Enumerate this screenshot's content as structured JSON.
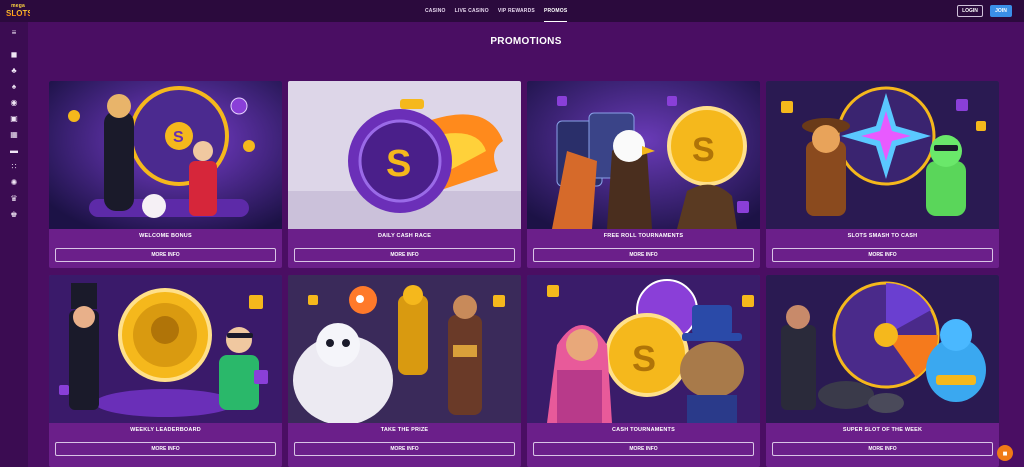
{
  "brand": {
    "line1": "mega",
    "line2": "SLOTS"
  },
  "nav": [
    {
      "label": "CASINO",
      "active": false
    },
    {
      "label": "LIVE CASINO",
      "active": false
    },
    {
      "label": "VIP REWARDS",
      "active": false
    },
    {
      "label": "PROMOS",
      "active": true
    }
  ],
  "auth": {
    "login": "LOGIN",
    "join": "JOIN"
  },
  "sidebar": [
    {
      "icon": "menu-icon",
      "glyph": "≡"
    },
    {
      "icon": "chat-icon",
      "glyph": "◼"
    },
    {
      "icon": "cherry-icon",
      "glyph": "♣"
    },
    {
      "icon": "spade-icon",
      "glyph": "♠"
    },
    {
      "icon": "hat-icon",
      "glyph": "◉"
    },
    {
      "icon": "cards-icon",
      "glyph": "▣"
    },
    {
      "icon": "ticket-icon",
      "glyph": "▦"
    },
    {
      "icon": "table-icon",
      "glyph": "▬"
    },
    {
      "icon": "grid-icon",
      "glyph": "∷"
    },
    {
      "icon": "chip-icon",
      "glyph": "✺"
    },
    {
      "icon": "trophy-icon",
      "glyph": "♛"
    },
    {
      "icon": "crown-icon",
      "glyph": "♚"
    }
  ],
  "page": {
    "title": "PROMOTIONS"
  },
  "promos": [
    {
      "name": "WELCOME BONUS",
      "button": "MORE INFO",
      "theme": "welcome"
    },
    {
      "name": "DAILY CASH RACE",
      "button": "MORE INFO",
      "theme": "race"
    },
    {
      "name": "FREE ROLL TOURNAMENTS",
      "button": "MORE INFO",
      "theme": "freeroll"
    },
    {
      "name": "SLOTS SMASH TO CASH",
      "button": "MORE INFO",
      "theme": "smash"
    },
    {
      "name": "WEEKLY LEADERBOARD",
      "button": "MORE INFO",
      "theme": "leaderboard"
    },
    {
      "name": "TAKE THE PRIZE",
      "button": "MORE INFO",
      "theme": "prize"
    },
    {
      "name": "CASH TOURNAMENTS",
      "button": "MORE INFO",
      "theme": "cash"
    },
    {
      "name": "SUPER SLOT OF THE WEEK",
      "button": "MORE INFO",
      "theme": "super"
    }
  ],
  "colors": {
    "background": "#4a0e63",
    "topbar": "#2b0a3d",
    "card": "#6b1f8a",
    "join": "#3a8fe8",
    "gold": "#f5b81c",
    "chat": "#f07a16"
  }
}
